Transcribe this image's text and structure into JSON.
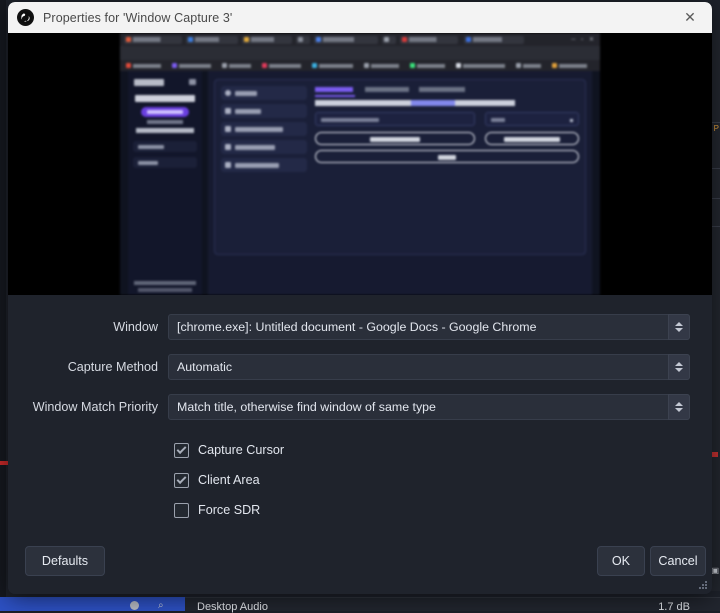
{
  "dialog": {
    "title": "Properties for 'Window Capture 3'",
    "app_icon": "obs-logo-icon",
    "close_icon": "✕"
  },
  "preview": {
    "name": "source-preview",
    "description": "Blurred Google Chrome window showing a dark-themed web application"
  },
  "form": {
    "fields": [
      {
        "label": "Window",
        "value": "[chrome.exe]: Untitled document - Google Docs - Google Chrome",
        "name": "window-combobox"
      },
      {
        "label": "Capture Method",
        "value": "Automatic",
        "name": "capture-method-combobox"
      },
      {
        "label": "Window Match Priority",
        "value": "Match title, otherwise find window of same type",
        "name": "window-match-priority-combobox"
      }
    ],
    "checkboxes": [
      {
        "label": "Capture Cursor",
        "checked": true,
        "name": "capture-cursor-checkbox"
      },
      {
        "label": "Client Area",
        "checked": true,
        "name": "client-area-checkbox"
      },
      {
        "label": "Force SDR",
        "checked": false,
        "name": "force-sdr-checkbox"
      }
    ]
  },
  "footer": {
    "defaults_label": "Defaults",
    "ok_label": "OK",
    "cancel_label": "Cancel"
  },
  "background": {
    "mixer_source": "Desktop Audio",
    "mixer_level": "1.7 dB"
  },
  "colors": {
    "titlebar": "#f3f3f3",
    "dialog_bg": "#1f232c",
    "field_bg": "#2a2f3a",
    "accent_blue": "#2d51c4",
    "accent_red": "#cc2a2a",
    "preview_accent": "#6a3fe0"
  }
}
